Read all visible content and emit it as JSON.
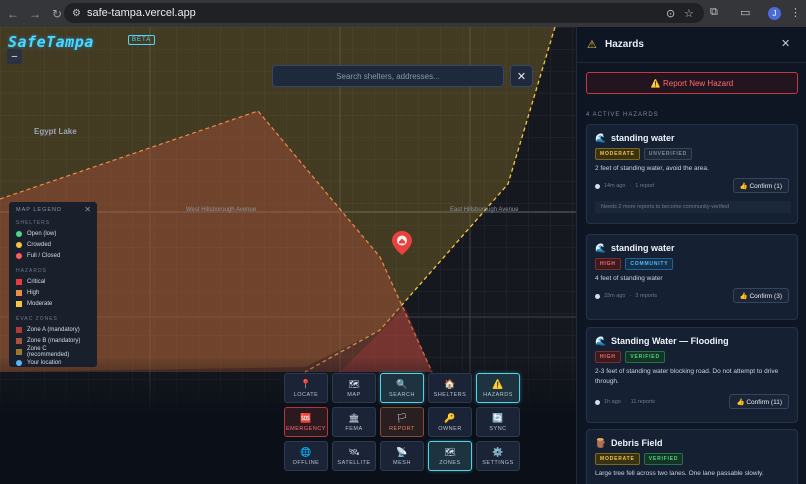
{
  "browser": {
    "url": "safe-tampa.vercel.app"
  },
  "app": {
    "logo": "SafeTampa",
    "beta": "BETA"
  },
  "search": {
    "placeholder": "Search shelters, addresses...",
    "close": "✕"
  },
  "map": {
    "zoom_out": "−",
    "labels": [
      "Egypt Lake"
    ],
    "streets": [
      "West Hillsborough Avenue",
      "East Hillsborough Avenue"
    ]
  },
  "legend": {
    "title": "MAP LEGEND",
    "close": "✕",
    "sections": [
      {
        "title": "SHELTERS",
        "items": [
          {
            "label": "Open (low)",
            "color": "#4ed48b",
            "shape": "dot"
          },
          {
            "label": "Crowded",
            "color": "#f5c542",
            "shape": "dot"
          },
          {
            "label": "Full / Closed",
            "color": "#ff5a5f",
            "shape": "dot"
          }
        ]
      },
      {
        "title": "HAZARDS",
        "items": [
          {
            "label": "Critical",
            "color": "#e83a3f",
            "shape": "sq"
          },
          {
            "label": "High",
            "color": "#ef8a4a",
            "shape": "sq"
          },
          {
            "label": "Moderate",
            "color": "#f5c542",
            "shape": "sq"
          }
        ]
      },
      {
        "title": "EVAC ZONES",
        "items": [
          {
            "label": "Zone A (mandatory)",
            "color": "#b03a3a",
            "shape": "sq"
          },
          {
            "label": "Zone B (mandatory)",
            "color": "#a8533a",
            "shape": "sq"
          },
          {
            "label": "Zone C (recommended)",
            "color": "#9a7a2a",
            "shape": "sq"
          },
          {
            "label": "Your location",
            "color": "#5ab8f5",
            "shape": "dot"
          }
        ]
      }
    ]
  },
  "toolbar": [
    {
      "id": "locate",
      "label": "LOCATE",
      "icon": "📍",
      "style": ""
    },
    {
      "id": "map",
      "label": "MAP",
      "icon": "🗺",
      "style": ""
    },
    {
      "id": "search",
      "label": "SEARCH",
      "icon": "🔍",
      "style": "active"
    },
    {
      "id": "shelters",
      "label": "SHELTERS",
      "icon": "🏠",
      "style": ""
    },
    {
      "id": "hazards",
      "label": "HAZARDS",
      "icon": "⚠️",
      "style": "active"
    },
    {
      "id": "emergency",
      "label": "EMERGENCY",
      "icon": "🆘",
      "style": "red"
    },
    {
      "id": "fema",
      "label": "FEMA",
      "icon": "🏛",
      "style": ""
    },
    {
      "id": "report",
      "label": "REPORT",
      "icon": "🏳",
      "style": "orange"
    },
    {
      "id": "owner",
      "label": "OWNER",
      "icon": "🔑",
      "style": ""
    },
    {
      "id": "sync",
      "label": "SYNC",
      "icon": "🔄",
      "style": ""
    },
    {
      "id": "offline",
      "label": "OFFLINE",
      "icon": "🌐",
      "style": ""
    },
    {
      "id": "satellite",
      "label": "SATELLITE",
      "icon": "🛰",
      "style": ""
    },
    {
      "id": "mesh",
      "label": "MESH",
      "icon": "📡",
      "style": ""
    },
    {
      "id": "zones",
      "label": "ZONES",
      "icon": "🗺",
      "style": "active"
    },
    {
      "id": "settings",
      "label": "SETTINGS",
      "icon": "⚙️",
      "style": ""
    }
  ],
  "panel": {
    "title": "Hazards",
    "close": "✕",
    "report_button": "⚠️ Report New Hazard",
    "active_count": "4 ACTIVE HAZARDS",
    "cards": [
      {
        "icon": "🌊",
        "title": "standing water",
        "severity": "MODERATE",
        "severity_class": "b-mod",
        "status": "UNVERIFIED",
        "status_class": "b-unv",
        "desc": "2 feet of standing water, avoid the area.",
        "age": "14m ago",
        "reports": "1 report",
        "confirm": "👍 Confirm (1)",
        "note": "Needs 2 more reports to become community-verified"
      },
      {
        "icon": "🌊",
        "title": "standing water",
        "severity": "HIGH",
        "severity_class": "b-high",
        "status": "COMMUNITY",
        "status_class": "b-com",
        "desc": "4 feet of standing water",
        "age": "33m ago",
        "reports": "3 reports",
        "confirm": "👍 Confirm (3)",
        "note": ""
      },
      {
        "icon": "🌊",
        "title": "Standing Water — Flooding",
        "severity": "HIGH",
        "severity_class": "b-high",
        "status": "VERIFIED",
        "status_class": "b-ver",
        "desc": "2-3 feet of standing water blocking road. Do not attempt to drive through.",
        "age": "1h ago",
        "reports": "11 reports",
        "confirm": "👍 Confirm (11)",
        "note": ""
      },
      {
        "icon": "🪵",
        "title": "Debris Field",
        "severity": "MODERATE",
        "severity_class": "b-mod",
        "status": "VERIFIED",
        "status_class": "b-ver",
        "desc": "Large tree fell across two lanes. One lane passable slowly.",
        "age": "",
        "reports": "",
        "confirm": "",
        "note": ""
      }
    ]
  }
}
